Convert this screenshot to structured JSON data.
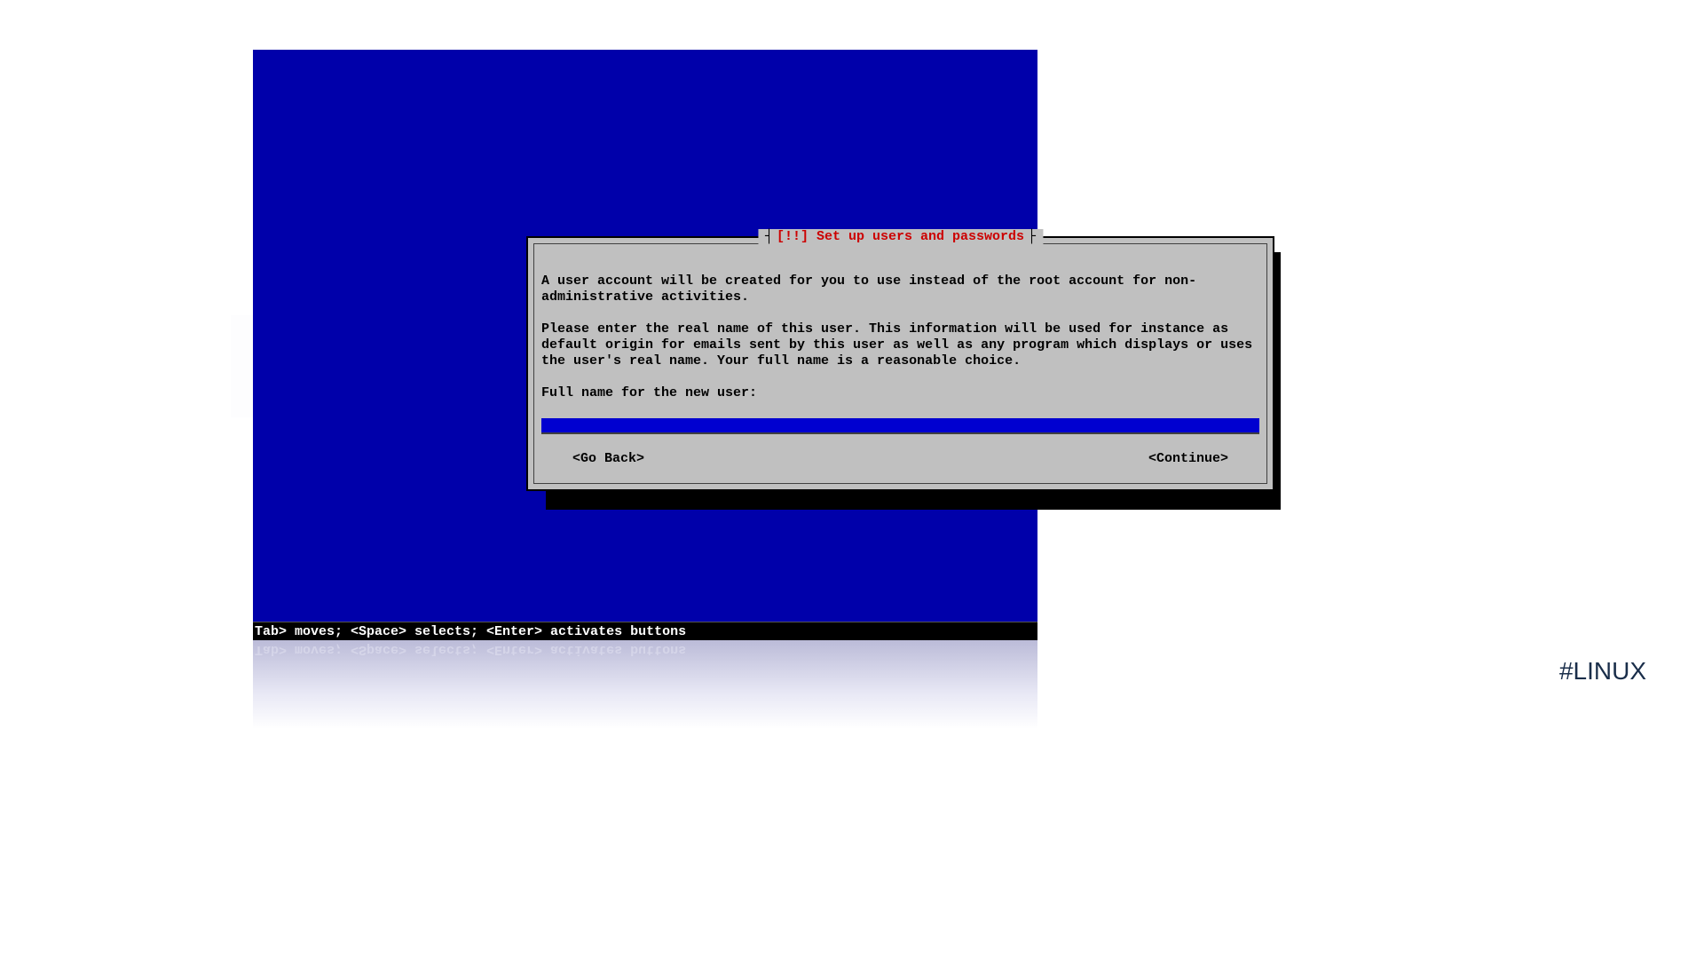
{
  "dialog": {
    "title": "[!!] Set up users and passwords",
    "paragraph1": "A user account will be created for you to use instead of the root account for non-administrative activities.",
    "paragraph2": "Please enter the real name of this user. This information will be used for instance as default origin for emails sent by this user as well as any program which displays or uses the user's real name. Your full name is a reasonable choice.",
    "prompt_label": "Full name for the new user:",
    "input_value": "",
    "go_back_label": "<Go Back>",
    "continue_label": "<Continue>"
  },
  "help_bar": "Tab> moves; <Space> selects; <Enter> activates buttons",
  "hashtag": "#LINUX"
}
